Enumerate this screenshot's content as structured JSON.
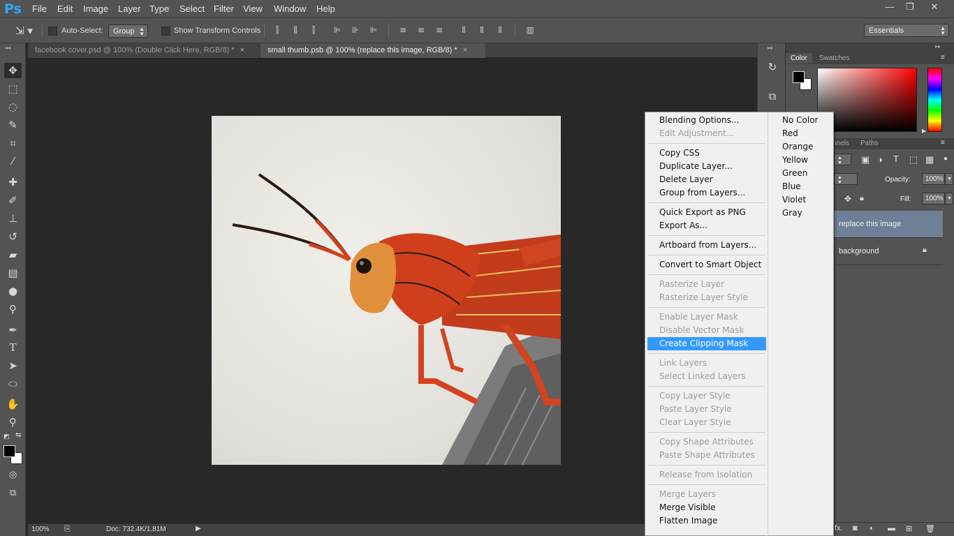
{
  "app": {
    "logo": "Ps"
  },
  "menubar": [
    "File",
    "Edit",
    "Image",
    "Layer",
    "Type",
    "Select",
    "Filter",
    "View",
    "Window",
    "Help"
  ],
  "window_controls": {
    "minimize": "—",
    "restore": "❐",
    "close": "✕"
  },
  "options": {
    "auto_select_label": "Auto-Select:",
    "auto_select_checked": false,
    "auto_select_target": "Group",
    "transform_controls_label": "Show Transform Controls",
    "transform_controls_checked": false,
    "workspace": "Essentials"
  },
  "tabs": [
    {
      "label": "facebook cover.psd @ 100% (Double Click Here, RGB/8) *",
      "close": "×",
      "active": false
    },
    {
      "label": "small thumb.psb @ 100% (replace this image, RGB/8) *",
      "close": "×",
      "active": true
    }
  ],
  "status": {
    "zoom": "100%",
    "doc": "Doc: 732.4K/1.81M"
  },
  "panels": {
    "color_tabs": [
      "Color",
      "Swatches"
    ],
    "layers_tabs": [
      "nnels",
      "Paths"
    ],
    "opacity_label": "Opacity:",
    "opacity_value": "100%",
    "fill_label": "Fill:",
    "fill_value": "100%",
    "layers": [
      {
        "name": "replace this image",
        "selected": true,
        "locked": false
      },
      {
        "name": "background",
        "selected": false,
        "locked": true
      }
    ]
  },
  "context_menu": {
    "items": [
      {
        "label": "Blending Options...",
        "enabled": true
      },
      {
        "label": "Edit Adjustment...",
        "enabled": false
      },
      {
        "sep": true
      },
      {
        "label": "Copy CSS",
        "enabled": true
      },
      {
        "label": "Duplicate Layer...",
        "enabled": true
      },
      {
        "label": "Delete Layer",
        "enabled": true
      },
      {
        "label": "Group from Layers...",
        "enabled": true
      },
      {
        "sep": true
      },
      {
        "label": "Quick Export as PNG",
        "enabled": true
      },
      {
        "label": "Export As...",
        "enabled": true
      },
      {
        "sep": true
      },
      {
        "label": "Artboard from Layers...",
        "enabled": true
      },
      {
        "sep": true
      },
      {
        "label": "Convert to Smart Object",
        "enabled": true
      },
      {
        "sep": true
      },
      {
        "label": "Rasterize Layer",
        "enabled": false
      },
      {
        "label": "Rasterize Layer Style",
        "enabled": false
      },
      {
        "sep": true
      },
      {
        "label": "Enable Layer Mask",
        "enabled": false
      },
      {
        "label": "Disable Vector Mask",
        "enabled": false
      },
      {
        "label": "Create Clipping Mask",
        "enabled": true,
        "highlighted": true
      },
      {
        "sep": true
      },
      {
        "label": "Link Layers",
        "enabled": false
      },
      {
        "label": "Select Linked Layers",
        "enabled": false
      },
      {
        "sep": true
      },
      {
        "label": "Copy Layer Style",
        "enabled": false
      },
      {
        "label": "Paste Layer Style",
        "enabled": false
      },
      {
        "label": "Clear Layer Style",
        "enabled": false
      },
      {
        "sep": true
      },
      {
        "label": "Copy Shape Attributes",
        "enabled": false
      },
      {
        "label": "Paste Shape Attributes",
        "enabled": false
      },
      {
        "sep": true
      },
      {
        "label": "Release from Isolation",
        "enabled": false
      },
      {
        "sep": true
      },
      {
        "label": "Merge Layers",
        "enabled": false
      },
      {
        "label": "Merge Visible",
        "enabled": true
      },
      {
        "label": "Flatten Image",
        "enabled": true
      }
    ],
    "colors": [
      "No Color",
      "Red",
      "Orange",
      "Yellow",
      "Green",
      "Blue",
      "Violet",
      "Gray"
    ]
  },
  "icons": {
    "tools": [
      "move-icon",
      "marquee-icon",
      "lasso-icon",
      "quick-select-icon",
      "crop-icon",
      "eyedropper-icon",
      "healing-brush-icon",
      "brush-icon",
      "clone-stamp-icon",
      "history-brush-icon",
      "eraser-icon",
      "gradient-icon",
      "blur-icon",
      "dodge-icon",
      "pen-icon",
      "type-icon",
      "path-select-icon",
      "ellipse-icon",
      "hand-icon",
      "zoom-icon"
    ],
    "accent": "#3399ff"
  }
}
